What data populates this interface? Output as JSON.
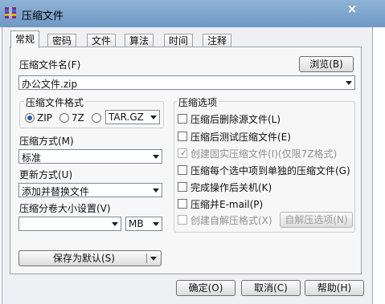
{
  "window": {
    "title": "压缩文件",
    "close_glyph": "×"
  },
  "tabs": [
    "常规",
    "密码",
    "文件",
    "算法",
    "时间",
    "注释"
  ],
  "general": {
    "archive_name_label": "压缩文件名(F)",
    "browse_button": "浏览(B)",
    "archive_name_value": "办公文件.zip",
    "format_group": {
      "title": "压缩文件格式",
      "options": [
        "ZIP",
        "7Z",
        "TAR.GZ"
      ],
      "selected": "ZIP"
    },
    "method": {
      "label": "压缩方式(M)",
      "value": "标准"
    },
    "update": {
      "label": "更新方式(U)",
      "value": "添加并替换文件"
    },
    "split": {
      "label": "压缩分卷大小设置(V)",
      "value": "",
      "unit": "MB"
    },
    "save_default_button": "保存为默认(S)",
    "options_group": {
      "title": "压缩选项",
      "items": [
        {
          "label": "压缩后删除源文件(L)",
          "checked": false,
          "enabled": true
        },
        {
          "label": "压缩后测试压缩文件(E)",
          "checked": false,
          "enabled": true
        },
        {
          "label": "创建固实压缩文件(I)(仅限7Z格式)",
          "checked": true,
          "enabled": false
        },
        {
          "label": "压缩每个选中项到单独的压缩文件(G)",
          "checked": false,
          "enabled": true
        },
        {
          "label": "完成操作后关机(K)",
          "checked": false,
          "enabled": true
        },
        {
          "label": "压缩并E-mail(P)",
          "checked": false,
          "enabled": true
        },
        {
          "label": "创建自解压格式(X)",
          "checked": false,
          "enabled": false
        }
      ],
      "sfx_button": "自解压选项(N)"
    }
  },
  "footer": {
    "ok": "确定(O)",
    "cancel": "取消(C)",
    "help": "帮助(H)"
  }
}
